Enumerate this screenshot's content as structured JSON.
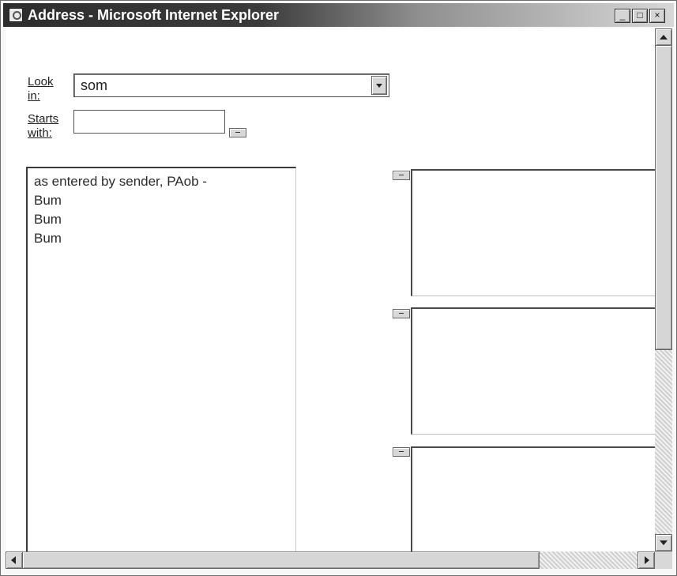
{
  "window": {
    "title": "Address - Microsoft Internet Explorer",
    "controls": {
      "minimize": "_",
      "maximize": "□",
      "close": "×"
    }
  },
  "form": {
    "look_in_label_line1": "Look",
    "look_in_label_line2": "in:",
    "look_in_value": "som",
    "starts_with_label_line1": "Starts",
    "starts_with_label_line2": "with:",
    "starts_with_value": ""
  },
  "list": {
    "items": [
      "as entered by sender, PAob -",
      "Bum",
      "Bum",
      "Bum"
    ]
  },
  "icons": {
    "app": "internet-explorer-icon",
    "dropdown": "chevron-down-icon",
    "small_button": "minus-icon",
    "scroll_up": "arrow-up-icon",
    "scroll_down": "arrow-down-icon",
    "scroll_left": "arrow-left-icon",
    "scroll_right": "arrow-right-icon"
  }
}
